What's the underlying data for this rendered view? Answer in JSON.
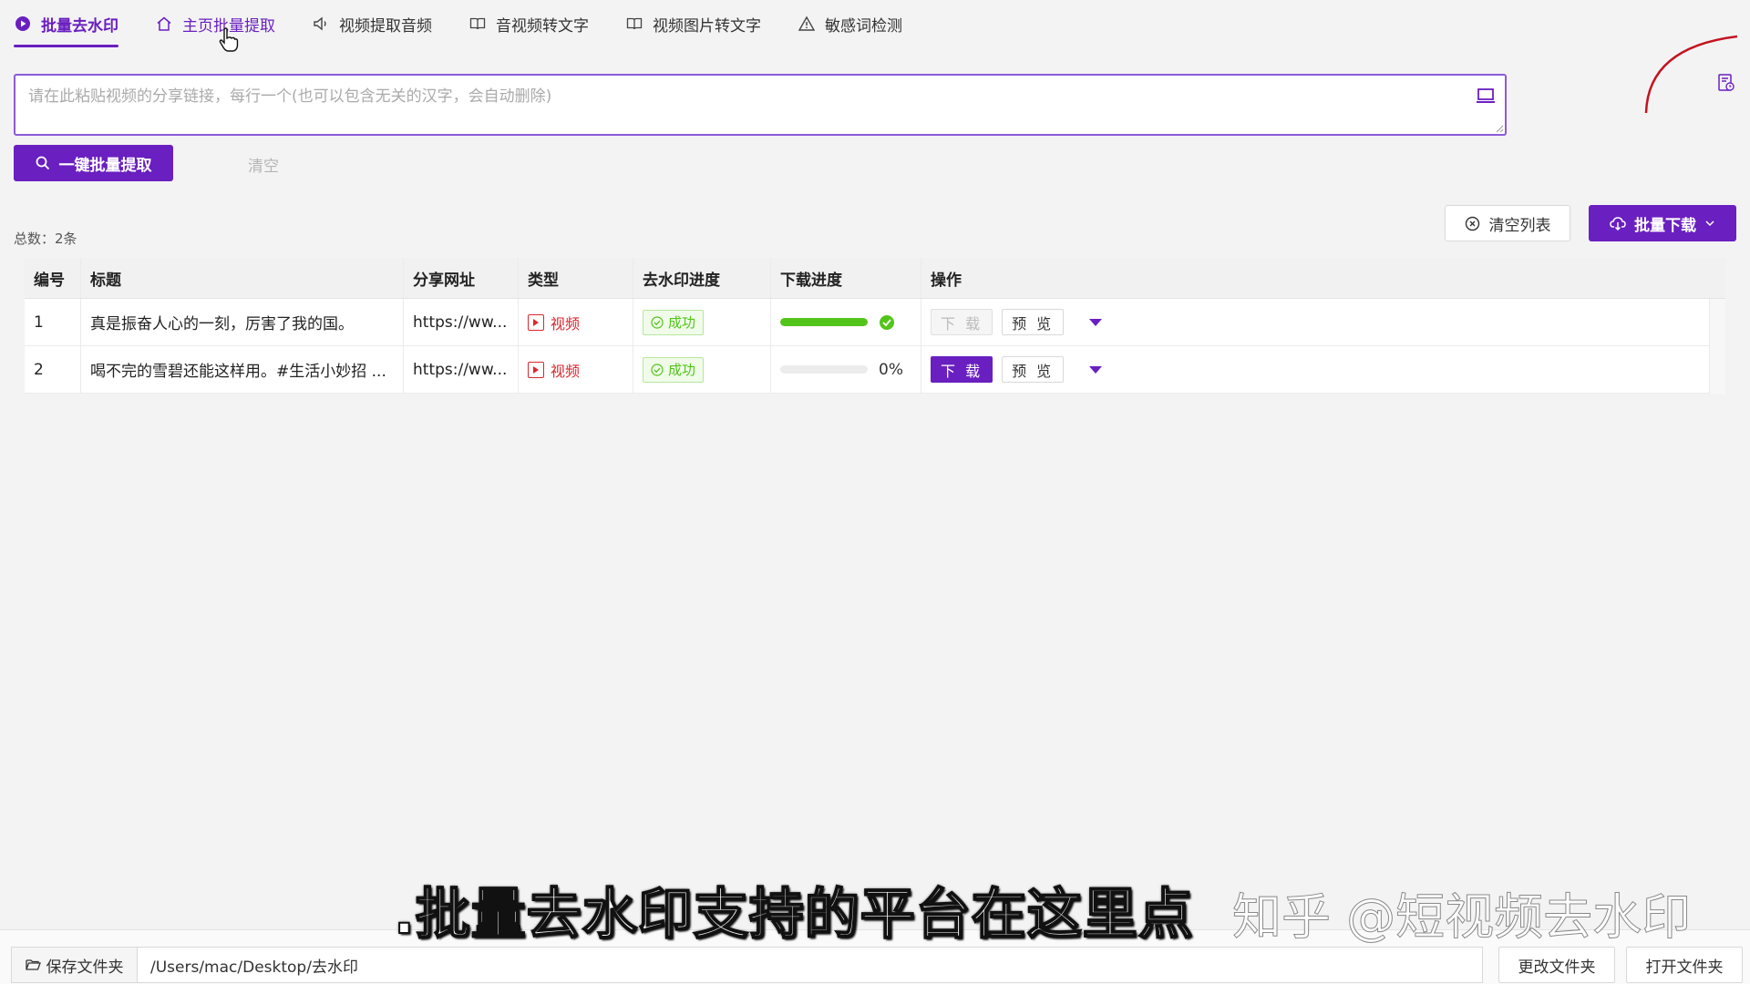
{
  "tabs": [
    {
      "label": "批量去水印",
      "icon": "play-circle-icon",
      "active": true
    },
    {
      "label": "主页批量提取",
      "icon": "home-icon"
    },
    {
      "label": "视频提取音频",
      "icon": "speaker-icon"
    },
    {
      "label": "音视频转文字",
      "icon": "book-icon"
    },
    {
      "label": "视频图片转文字",
      "icon": "book-icon"
    },
    {
      "label": "敏感词检测",
      "icon": "warning-icon"
    }
  ],
  "input": {
    "placeholder": "请在此粘贴视频的分享链接，每行一个(也可以包含无关的汉字，会自动删除)",
    "value": ""
  },
  "actions": {
    "extract_label": "一键批量提取",
    "clear_label": "清空"
  },
  "total_label": "总数：2条",
  "toolbar": {
    "clear_list_label": "清空列表",
    "batch_download_label": "批量下载"
  },
  "table": {
    "columns": [
      "编号",
      "标题",
      "分享网址",
      "类型",
      "去水印进度",
      "下载进度",
      "操作"
    ],
    "rows": [
      {
        "no": "1",
        "title": "真是振奋人心的一刻，厉害了我的国。",
        "url": "https://ww...",
        "type": "视频",
        "watermark_status": "成功",
        "download_progress": 1.0,
        "download_done": true,
        "download_label": "下 载",
        "download_enabled": false,
        "preview_label": "预 览"
      },
      {
        "no": "2",
        "title": "喝不完的雪碧还能这样用。#生活小妙招 ...",
        "url": "https://ww...",
        "type": "视频",
        "watermark_status": "成功",
        "download_progress": 0.0,
        "percent_text": "0%",
        "download_done": false,
        "download_label": "下 载",
        "download_enabled": true,
        "preview_label": "预 览"
      }
    ]
  },
  "bottom": {
    "save_folder_label": "保存文件夹",
    "path": "/Users/mac/Desktop/去水印",
    "change_folder_label": "更改文件夹",
    "open_folder_label": "打开文件夹"
  },
  "subtitle": ".批量去水印支持的平台在这里点",
  "watermark": "知乎 @短视频去水印",
  "colors": {
    "accent": "#6a1fc0",
    "success": "#52c41a",
    "danger": "#d9282f"
  }
}
